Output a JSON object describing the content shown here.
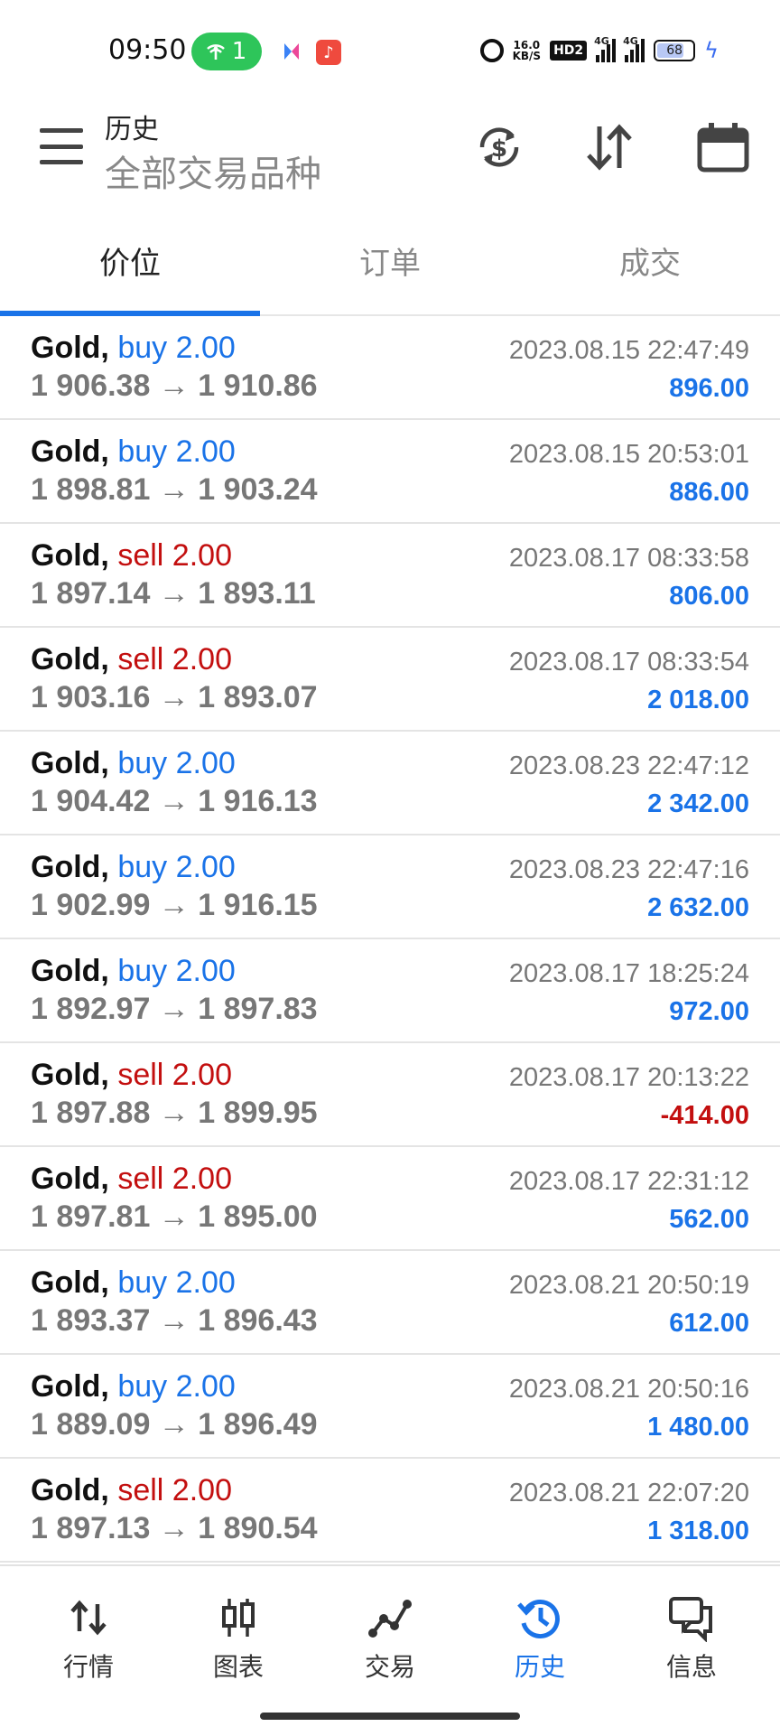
{
  "status_bar": {
    "time": "09:50",
    "hotspot_count": "1",
    "net_speed": "16.0",
    "net_speed_unit": "KB/S",
    "hd_label": "HD2",
    "sig1_label": "4G",
    "sig2_label": "4G",
    "battery": "68"
  },
  "header": {
    "title": "历史",
    "subtitle": "全部交易品种",
    "icons": [
      "menu-icon",
      "currency-refresh-icon",
      "sort-icon",
      "calendar-icon"
    ]
  },
  "tabs": [
    {
      "label": "价位",
      "active": true
    },
    {
      "label": "订单",
      "active": false
    },
    {
      "label": "成交",
      "active": false
    }
  ],
  "trades": [
    {
      "symbol": "Gold,",
      "side": "buy 2.00",
      "type": "buy",
      "prices": "1 906.38 → 1 910.86",
      "time": "2023.08.15 22:47:49",
      "profit": "896.00"
    },
    {
      "symbol": "Gold,",
      "side": "buy 2.00",
      "type": "buy",
      "prices": "1 898.81 → 1 903.24",
      "time": "2023.08.15 20:53:01",
      "profit": "886.00"
    },
    {
      "symbol": "Gold,",
      "side": "sell 2.00",
      "type": "sell",
      "prices": "1 897.14 → 1 893.11",
      "time": "2023.08.17 08:33:58",
      "profit": "806.00"
    },
    {
      "symbol": "Gold,",
      "side": "sell 2.00",
      "type": "sell",
      "prices": "1 903.16 → 1 893.07",
      "time": "2023.08.17 08:33:54",
      "profit": "2 018.00"
    },
    {
      "symbol": "Gold,",
      "side": "buy 2.00",
      "type": "buy",
      "prices": "1 904.42 → 1 916.13",
      "time": "2023.08.23 22:47:12",
      "profit": "2 342.00"
    },
    {
      "symbol": "Gold,",
      "side": "buy 2.00",
      "type": "buy",
      "prices": "1 902.99 → 1 916.15",
      "time": "2023.08.23 22:47:16",
      "profit": "2 632.00"
    },
    {
      "symbol": "Gold,",
      "side": "buy 2.00",
      "type": "buy",
      "prices": "1 892.97 → 1 897.83",
      "time": "2023.08.17 18:25:24",
      "profit": "972.00"
    },
    {
      "symbol": "Gold,",
      "side": "sell 2.00",
      "type": "sell",
      "prices": "1 897.88 → 1 899.95",
      "time": "2023.08.17 20:13:22",
      "profit": "-414.00"
    },
    {
      "symbol": "Gold,",
      "side": "sell 2.00",
      "type": "sell",
      "prices": "1 897.81 → 1 895.00",
      "time": "2023.08.17 22:31:12",
      "profit": "562.00"
    },
    {
      "symbol": "Gold,",
      "side": "buy 2.00",
      "type": "buy",
      "prices": "1 893.37 → 1 896.43",
      "time": "2023.08.21 20:50:19",
      "profit": "612.00"
    },
    {
      "symbol": "Gold,",
      "side": "buy 2.00",
      "type": "buy",
      "prices": "1 889.09 → 1 896.49",
      "time": "2023.08.21 20:50:16",
      "profit": "1 480.00"
    },
    {
      "symbol": "Gold,",
      "side": "sell 2.00",
      "type": "sell",
      "prices": "1 897.13 → 1 890.54",
      "time": "2023.08.21 22:07:20",
      "profit": "1 318.00"
    }
  ],
  "bottom_nav": [
    {
      "label": "行情",
      "icon": "quotes-icon",
      "active": false
    },
    {
      "label": "图表",
      "icon": "chart-icon",
      "active": false
    },
    {
      "label": "交易",
      "icon": "trade-icon",
      "active": false
    },
    {
      "label": "历史",
      "icon": "history-icon",
      "active": true
    },
    {
      "label": "信息",
      "icon": "messages-icon",
      "active": false
    }
  ],
  "colors": {
    "accent": "#1a73e8",
    "sell": "#c30f0f",
    "buy": "#1a73e8",
    "muted": "#777777"
  }
}
